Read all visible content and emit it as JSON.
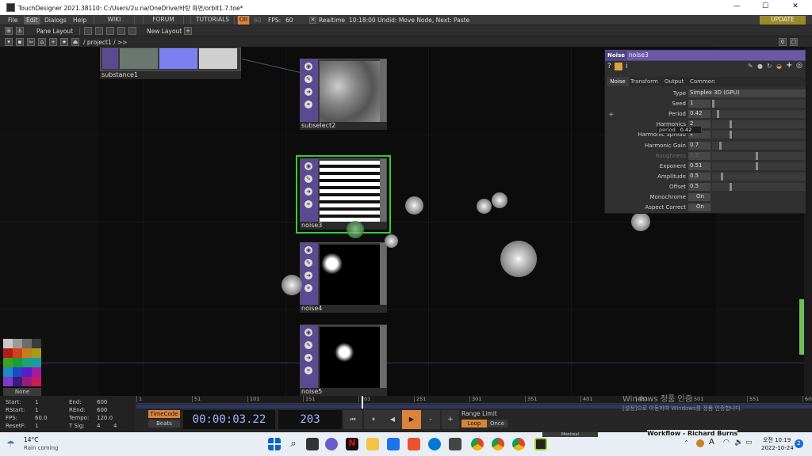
{
  "window": {
    "title": "TouchDesigner 2021.38110: C:/Users/2u.na/OneDrive/바탕 화면/orbit1.7.toe*",
    "min": "—",
    "max": "☐",
    "close": "✕"
  },
  "menu": {
    "file": "File",
    "edit": "Edit",
    "dialogs": "Dialogs",
    "help": "Help",
    "wiki": "WIKI",
    "forum": "FORUM",
    "tutorials": "TUTORIALS",
    "oii": "OII",
    "fps_target": "60",
    "fps_label": "FPS:",
    "fps_value": "60",
    "realtime": "Realtime",
    "status": "10:18:00 Undid: Move Node, Next: Paste",
    "update": "UPDATE"
  },
  "toolbar": {
    "pane_layout": "Pane Layout",
    "new_layout": "New Layout",
    "plus": "+"
  },
  "path": {
    "text": "/ project1 / >>",
    "zero": "0",
    "pane": "▢"
  },
  "nodes": [
    {
      "label": "substance1"
    },
    {
      "label": "subselect2"
    },
    {
      "label": "noise3"
    },
    {
      "label": "noise4"
    },
    {
      "label": "noise5"
    }
  ],
  "params": {
    "type_label": "Noise",
    "op_name": "noise3",
    "tabs": [
      "Noise",
      "Transform",
      "Output",
      "Common"
    ],
    "rows": [
      {
        "label": "Type",
        "value": "Simplex 3D (GPU)"
      },
      {
        "label": "Seed",
        "value": "1"
      },
      {
        "label": "Period",
        "value": "0.42"
      },
      {
        "label": "Harmonics",
        "value": "2"
      },
      {
        "label": "Harmonic Spread",
        "value": "2"
      },
      {
        "label": "Harmonic Gain",
        "value": "0.7"
      },
      {
        "label": "Roughness",
        "value": "0.5"
      },
      {
        "label": "Exponent",
        "value": "0.51"
      },
      {
        "label": "Amplitude",
        "value": "0.5"
      },
      {
        "label": "Offset",
        "value": "0.5"
      },
      {
        "label": "Monochrome",
        "value": "On"
      },
      {
        "label": "Aspect Correct",
        "value": "On"
      }
    ],
    "tooltip_name": "period",
    "tooltip_value": "0.42",
    "plus": "+"
  },
  "palette": {
    "none_label": "None",
    "colors": [
      "#c8c8c8",
      "#9a9a9a",
      "#6c6c6c",
      "#3c3c3c",
      "#b31b1b",
      "#d0421b",
      "#c97c1c",
      "#a49a1c",
      "#3ea21c",
      "#1c9a3c",
      "#1ca27a",
      "#1c9aa2",
      "#1c8ac9",
      "#1c4ac9",
      "#5a1cc9",
      "#a21ca2",
      "#7a3cc9",
      "#3c1c7a",
      "#9a1c7a",
      "#c91c5a"
    ]
  },
  "timeline": {
    "start_label": "Start:",
    "start_value": "1",
    "end_label": "End:",
    "end_value": "600",
    "rstart_label": "RStart:",
    "rstart_value": "1",
    "rend_label": "REnd:",
    "rend_value": "600",
    "fps_label": "FPS:",
    "fps_value": "60.0",
    "tempo_label": "Tempo:",
    "tempo_value": "120.0",
    "resetf_label": "ResetF:",
    "resetf_value": "1",
    "tsig_label": "T Sig:",
    "tsig_a": "4",
    "tsig_b": "4",
    "ruler": [
      "1",
      "51",
      "101",
      "151",
      "201",
      "251",
      "301",
      "351",
      "401",
      "451",
      "501",
      "551",
      "600"
    ],
    "timecode_btn": "TimeCode",
    "beats_btn": "Beats",
    "timecode": "00:00:03.22",
    "frame": "203",
    "range_limit": "Range Limit",
    "loop": "Loop",
    "once": "Once"
  },
  "watermark": {
    "line1": "Windows 정품 인증",
    "line2": "[설정]으로 이동하여 Windows를 정품 인증합니다."
  },
  "taskbar": {
    "weather_temp": "14°C",
    "weather_desc": "Rain coming",
    "time": "오전 10:19",
    "date": "2022-10-24",
    "lang": "A",
    "notif": "2",
    "preview_left": "Montreal",
    "preview_right": "Workflow - Richard Burns"
  },
  "accent": {
    "node_side": "#5b4a93",
    "select": "#2cd12c",
    "timecode": "#d9843a",
    "params_header": "#4f4683"
  }
}
